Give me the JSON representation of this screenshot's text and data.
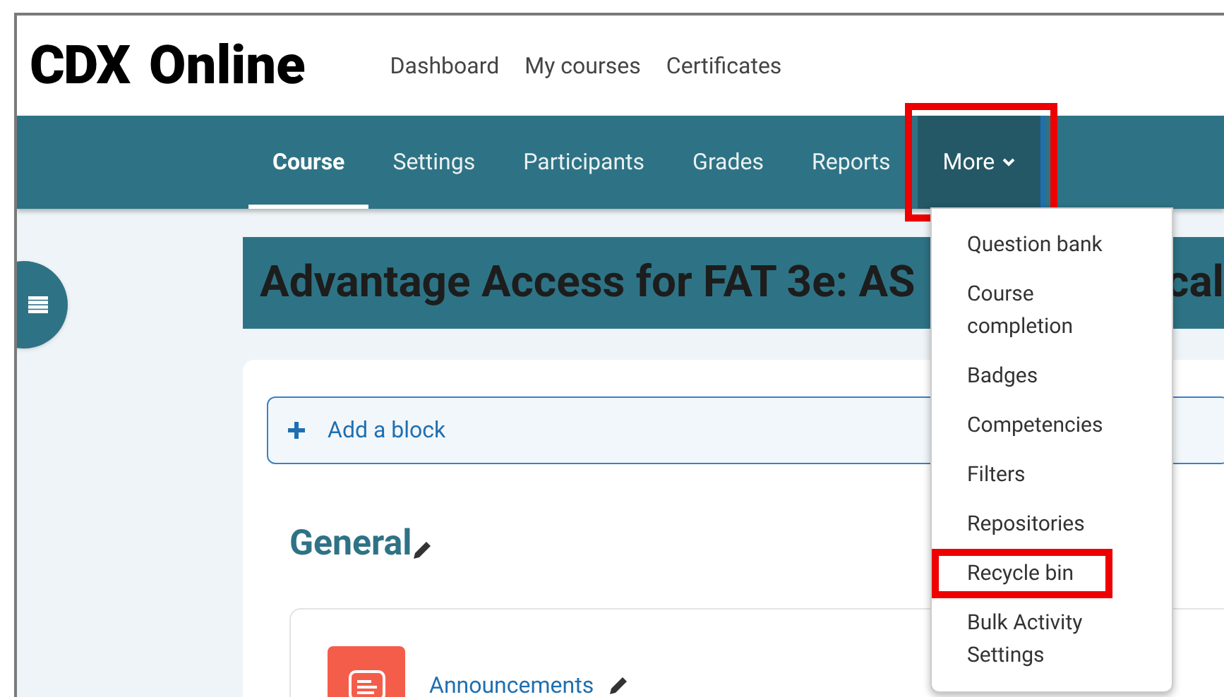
{
  "header": {
    "logo_mark": "CDX",
    "logo_text": "Online",
    "links": [
      "Dashboard",
      "My courses",
      "Certificates"
    ]
  },
  "nav": [
    {
      "label": "Course",
      "selected": true,
      "highlighted": false,
      "kind": "tab"
    },
    {
      "label": "Settings",
      "selected": false,
      "highlighted": false,
      "kind": "tab"
    },
    {
      "label": "Participants",
      "selected": false,
      "highlighted": false,
      "kind": "tab"
    },
    {
      "label": "Grades",
      "selected": false,
      "highlighted": false,
      "kind": "tab"
    },
    {
      "label": "Reports",
      "selected": false,
      "highlighted": false,
      "kind": "tab"
    },
    {
      "label": "More",
      "selected": false,
      "highlighted": true,
      "kind": "menu"
    }
  ],
  "dropdown": [
    {
      "label": "Question bank",
      "highlighted": false
    },
    {
      "label": "Course completion",
      "highlighted": false
    },
    {
      "label": "Badges",
      "highlighted": false
    },
    {
      "label": "Competencies",
      "highlighted": false
    },
    {
      "label": "Filters",
      "highlighted": false
    },
    {
      "label": "Repositories",
      "highlighted": false
    },
    {
      "label": "Recycle bin",
      "highlighted": true
    },
    {
      "label": "Bulk Activity Settings",
      "highlighted": false
    }
  ],
  "course_title": {
    "left": "Advantage Access for FAT 3e: AS",
    "right": "cal"
  },
  "add_block": "Add a block",
  "section": {
    "title": "General",
    "activity": "Announcements"
  }
}
